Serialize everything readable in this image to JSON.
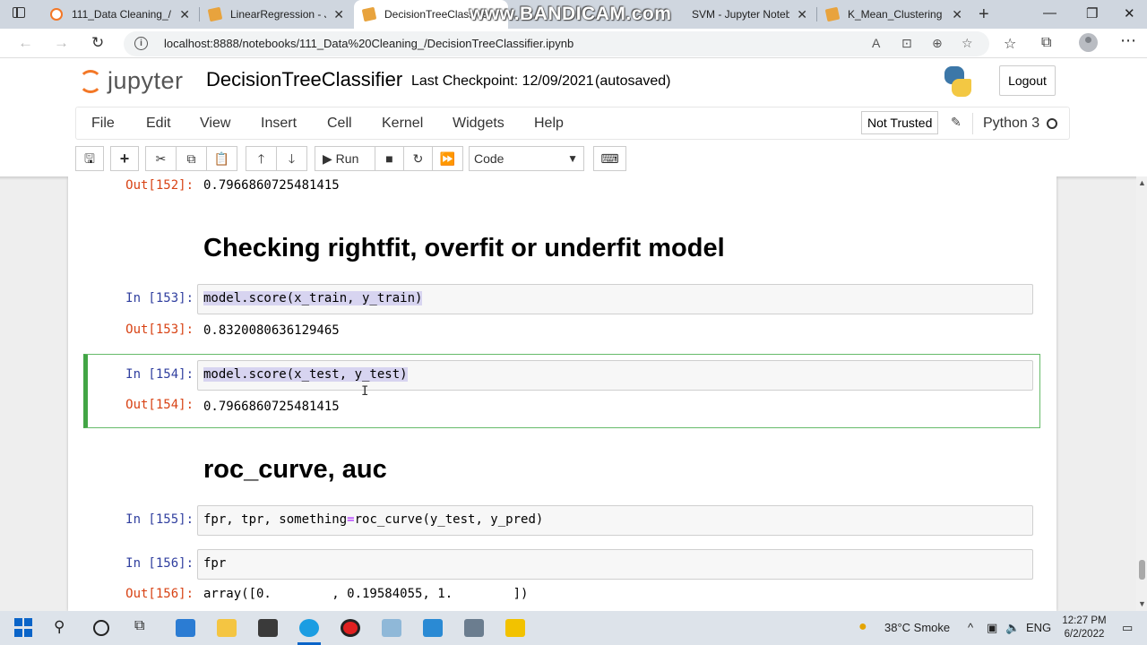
{
  "browser": {
    "watermark": "www.BANDICAM.com",
    "tabs": [
      {
        "title": "111_Data Cleaning_/",
        "active": false
      },
      {
        "title": "LinearRegression - Jupyter",
        "active": false
      },
      {
        "title": "DecisionTreeClassifier",
        "active": true
      },
      {
        "title": "SVM - Jupyter Notebook",
        "active": false
      },
      {
        "title": "K_Mean_Clustering - Jupyter",
        "active": false
      }
    ],
    "url": "localhost:8888/notebooks/111_Data%20Cleaning_/DecisionTreeClassifier.ipynb"
  },
  "jupyter": {
    "logo_text": "jupyter",
    "notebook_name": "DecisionTreeClassifier",
    "checkpoint": "Last Checkpoint: 12/09/2021",
    "autosaved": "(autosaved)",
    "logout": "Logout",
    "menu": [
      "File",
      "Edit",
      "View",
      "Insert",
      "Cell",
      "Kernel",
      "Widgets",
      "Help"
    ],
    "trust": "Not Trusted",
    "kernel": "Python 3",
    "toolbar": {
      "run_label": "Run",
      "cell_type": "Code"
    }
  },
  "cells": {
    "out152_prompt": "Out[152]:",
    "out152_value": "0.7966860725481415",
    "heading1": "Checking rightfit, overfit or underfit model",
    "in153_prompt": "In [153]:",
    "in153_code": "model.score(x_train, y_train)",
    "out153_prompt": "Out[153]:",
    "out153_value": "0.8320080636129465",
    "in154_prompt": "In [154]:",
    "in154_code": "model.score(x_test, y_test)",
    "out154_prompt": "Out[154]:",
    "out154_value": "0.7966860725481415",
    "heading2": "roc_curve, auc",
    "in155_prompt": "In [155]:",
    "in155_code_a": "fpr, tpr, something",
    "in155_code_eq": "=",
    "in155_code_b": "roc_curve(y_test, y_pred)",
    "in156_prompt": "In [156]:",
    "in156_code": "fpr",
    "out156_prompt": "Out[156]:",
    "out156_value": "array([0.        , 0.19584055, 1.        ])"
  },
  "taskbar": {
    "weather": "38°C  Smoke",
    "lang": "ENG",
    "time": "12:27 PM",
    "date": "6/2/2022"
  }
}
